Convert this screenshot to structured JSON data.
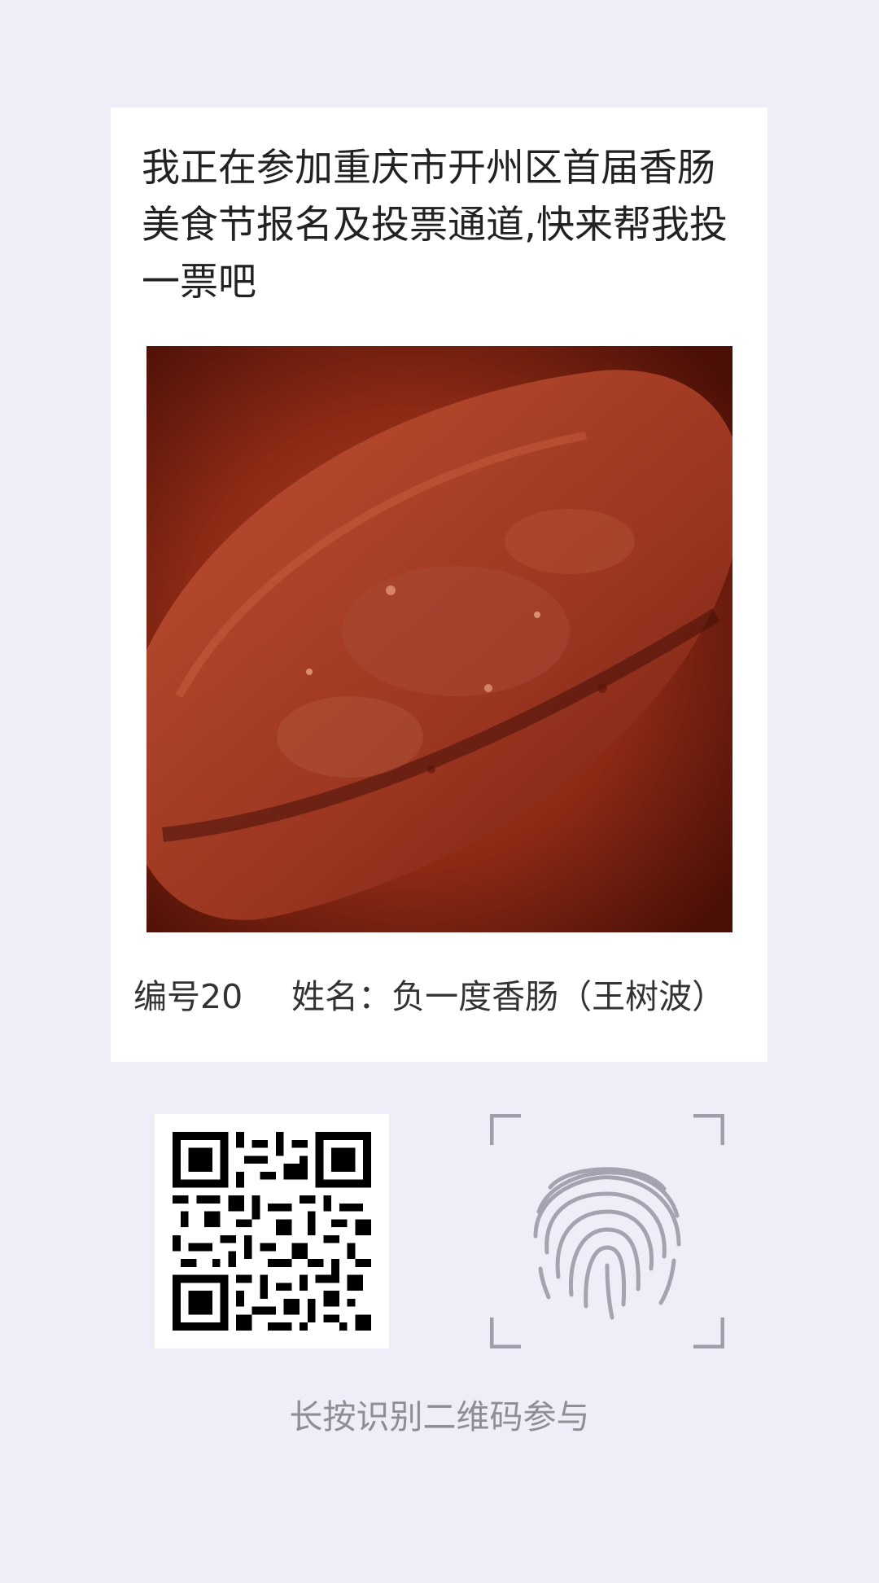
{
  "poster": {
    "headline": "我正在参加重庆市开州区首届香肠美食节报名及投票通道,快来帮我投一票吧",
    "entry_number": "编号20",
    "entry_name": "姓名：负一度香肠（王树波）",
    "photo_icon": "sausage-photo"
  },
  "scan": {
    "qr_icon": "qr-code-icon",
    "fingerprint_icon": "fingerprint-icon",
    "hint": "长按识别二维码参与"
  },
  "colors": {
    "page_background": "#efeef8",
    "card_background": "#ffffff",
    "hint_text": "#8e8e96",
    "fingerprint": "#a4a4b0"
  }
}
